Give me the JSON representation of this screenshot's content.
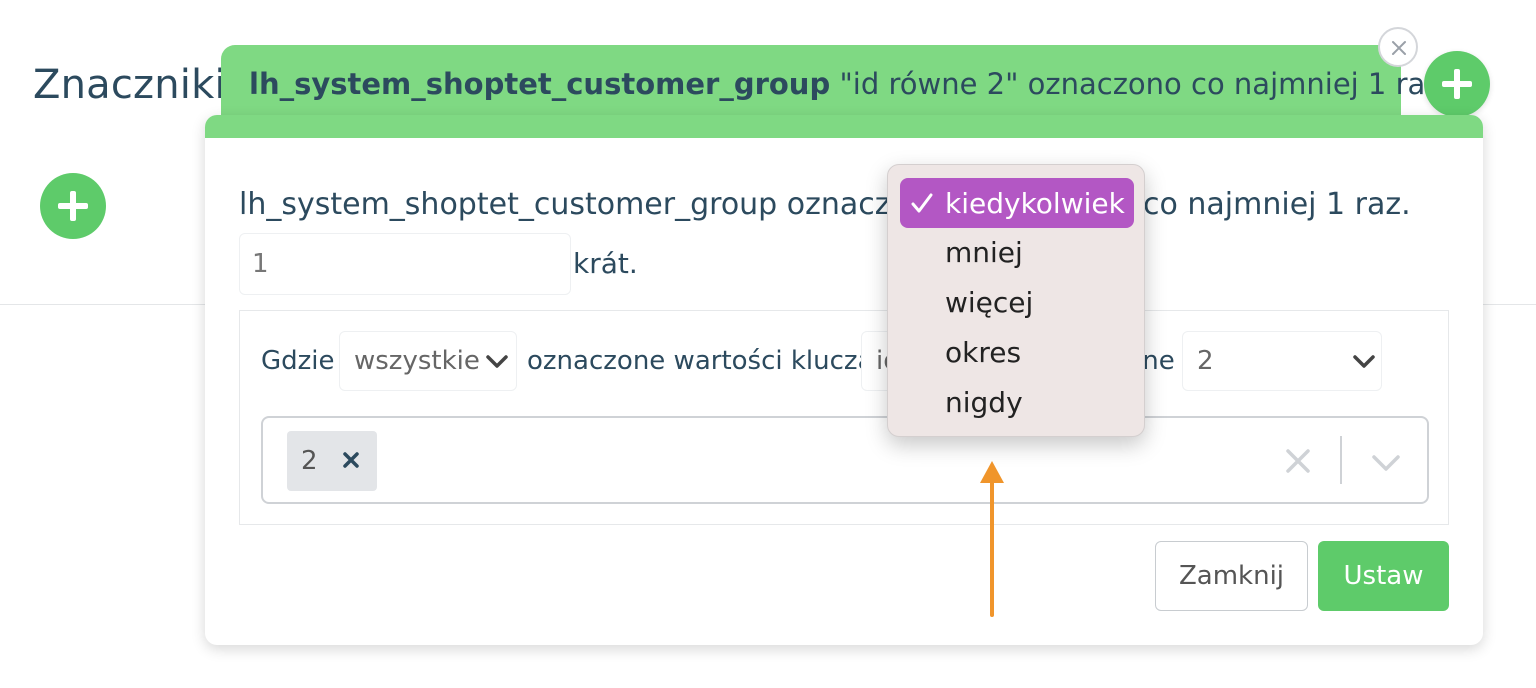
{
  "background": {
    "title": "Znaczniki"
  },
  "tag_header": {
    "key_name": "lh_system_shoptet_customer_group",
    "summary": "\"id równe 2\" oznaczono co najmniej 1 raz"
  },
  "dialog": {
    "sentence_prefix": "lh_system_shoptet_customer_group oznaczon",
    "sentence_suffix": "co najmniej 1 raz.",
    "count_value": "1",
    "count_suffix": "krát.",
    "where_label": "Gdzie",
    "scope_select_value": "wszystkie",
    "tagged_key_label": "oznaczone wartości klucza",
    "key_select_value": "id",
    "comparison_label": "równe",
    "value_select_value": "2",
    "chips": [
      "2"
    ],
    "close_button": "Zamknij",
    "set_button": "Ustaw"
  },
  "frequency_dropdown": {
    "options": [
      "kiedykolwiek",
      "mniej",
      "więcej",
      "okres",
      "nigdy"
    ],
    "selected": "kiedykolwiek",
    "selected_color": "#b357c4"
  },
  "colors": {
    "accent_green": "#5ecb6a",
    "header_green": "#7fd983",
    "text": "#2c4a5e",
    "annotation_arrow": "#f0952b"
  }
}
